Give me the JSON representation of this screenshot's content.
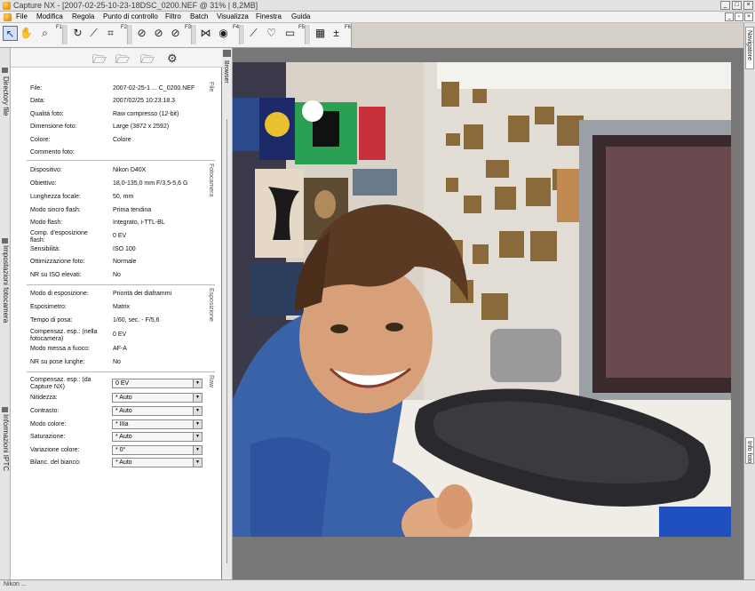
{
  "window": {
    "title": "Capture NX - [2007-02-25-10-23-18DSC_0200.NEF @ 31% | 8,2MB]"
  },
  "menu": [
    "File",
    "Modifica",
    "Regola",
    "Punto di controllo",
    "Filtro",
    "Batch",
    "Visualizza",
    "Finestra",
    "Guida"
  ],
  "toolbar": {
    "fkeys": [
      "F1",
      "F2",
      "F3",
      "F4",
      "F5",
      "F6"
    ]
  },
  "left_tabs": {
    "browser_dir": "Directory file",
    "camera_settings": "Impostazioni fotocamera",
    "iptc": "Informazioni IPTC"
  },
  "browser_tab": "Browser",
  "sections": {
    "file": "File",
    "camera": "Fotocamera",
    "exposure": "Esposizione",
    "raw": "Raw"
  },
  "file_info": [
    {
      "label": "File:",
      "value": "2007-02-25-1 ... C_0200.NEF"
    },
    {
      "label": "Data:",
      "value": "2007/02/25 10:23:18.3"
    },
    {
      "label": "Qualità foto:",
      "value": "Raw compresso (12-bit)"
    },
    {
      "label": "Dimensione foto:",
      "value": "Large (3872 x 2592)"
    },
    {
      "label": "Colore:",
      "value": "Colore"
    },
    {
      "label": "Commento foto:",
      "value": ""
    }
  ],
  "camera_info": [
    {
      "label": "Dispositivo:",
      "value": "Nikon D40X"
    },
    {
      "label": "Obiettivo:",
      "value": "18,0-135,0 mm F/3,5-5,6 G"
    },
    {
      "label": "Lunghezza focale:",
      "value": "50, mm"
    },
    {
      "label": "Modo sincro flash:",
      "value": "Prima tendina"
    },
    {
      "label": "Modo flash:",
      "value": "Integrato, i-TTL-BL"
    },
    {
      "label": "Comp. d'esposizione flash:",
      "value": "0 EV"
    },
    {
      "label": "Sensibilità:",
      "value": "ISO 100"
    },
    {
      "label": "Ottimizzazione foto:",
      "value": "Normale"
    },
    {
      "label": "NR su ISO elevati:",
      "value": "No"
    }
  ],
  "exposure_info": [
    {
      "label": "Modo di esposizione:",
      "value": "Priorità dei diaframmi"
    },
    {
      "label": "Esposimetro:",
      "value": "Matrix"
    },
    {
      "label": "Tempo di posa:",
      "value": "1/60, sec. - F/5,6"
    },
    {
      "label": "Compensaz. esp.: (nella fotocamera)",
      "value": "0 EV"
    },
    {
      "label": "Modo messa a fuoco:",
      "value": "AF-A"
    },
    {
      "label": "NR su pose lunghe:",
      "value": "No"
    }
  ],
  "raw_settings": [
    {
      "label": "Compensaz. esp.: (da Capture NX)",
      "value": "0 EV"
    },
    {
      "label": "Nitidezza:",
      "value": "* Auto"
    },
    {
      "label": "Contrasto:",
      "value": "* Auto"
    },
    {
      "label": "Modo colore:",
      "value": "* IIIa"
    },
    {
      "label": "Saturazione:",
      "value": "* Auto"
    },
    {
      "label": "Variazione colore:",
      "value": "* 0°"
    },
    {
      "label": "Bilanc. del bianco:",
      "value": "* Auto"
    }
  ],
  "right_tabs": {
    "navigator": "Navigatore",
    "photo_info": "Info foto"
  },
  "status": [
    "Nikon ..."
  ],
  "colors": {
    "canvas_bg": "#777777",
    "active_tool": "#cfe0f8",
    "panel_bg": "#ffffff"
  }
}
